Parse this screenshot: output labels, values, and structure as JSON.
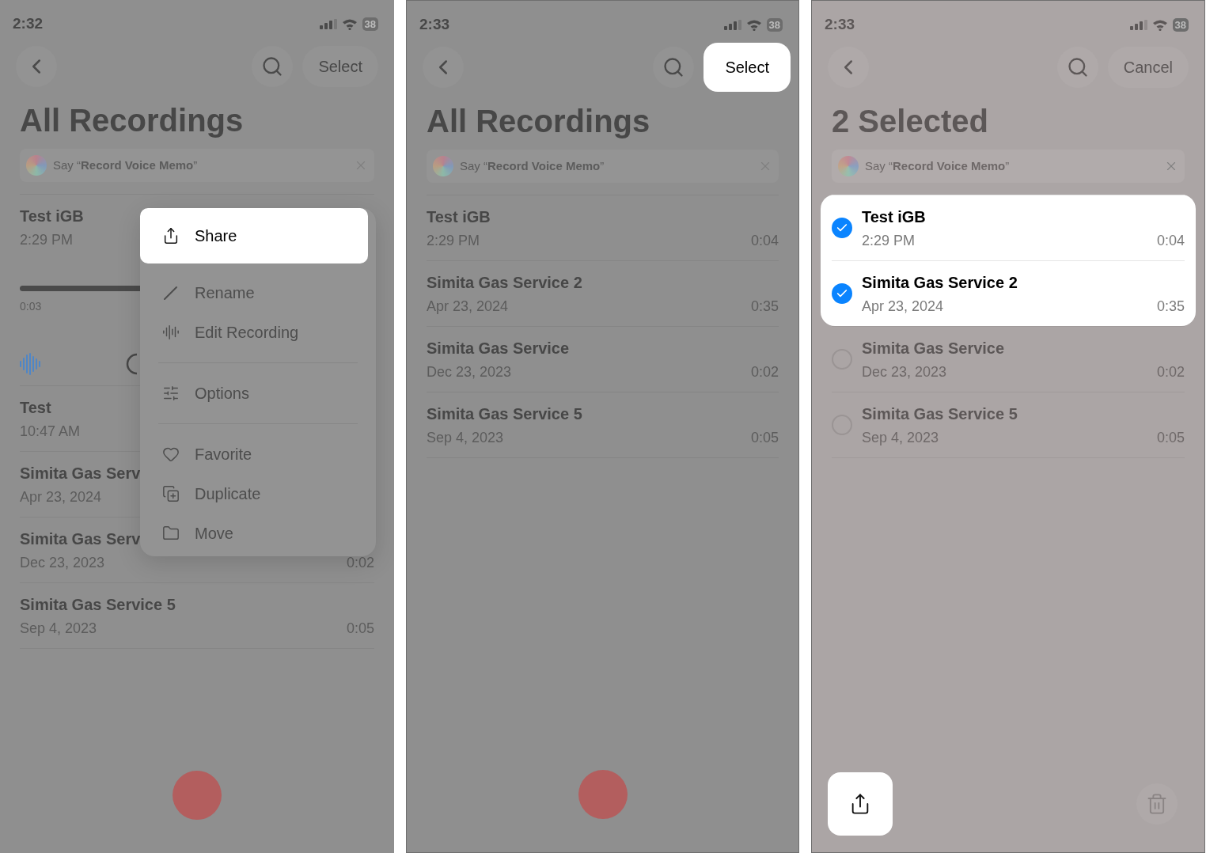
{
  "panels": [
    {
      "status_bar": {
        "time": "2:32",
        "battery": "38"
      },
      "nav": {
        "action": "Select",
        "action_highlighted": false
      },
      "title": "All Recordings",
      "siri_tip": "Say “**Record Voice Memo**”",
      "recordings": [
        {
          "title": "Test iGB",
          "subtitle": "2:29 PM",
          "expanded": true,
          "elapsed": "0:03"
        },
        {
          "title": "Test",
          "subtitle": "10:47 AM",
          "expanded": false
        },
        {
          "title": "Simita Gas Serv",
          "subtitle": "Apr 23, 2024",
          "expanded": false
        },
        {
          "title": "Simita Gas Serv",
          "subtitle": "Dec 23, 2023",
          "duration": "0:02",
          "expanded": false
        },
        {
          "title": "Simita Gas Service 5",
          "subtitle": "Sep 4, 2023",
          "duration": "0:05",
          "expanded": false
        }
      ],
      "context_menu": {
        "sections": [
          [
            {
              "kind": "share",
              "label": "Share",
              "highlighted": true
            },
            {
              "kind": "rename",
              "label": "Rename",
              "highlighted": false
            },
            {
              "kind": "edit",
              "label": "Edit Recording",
              "highlighted": false
            }
          ],
          [
            {
              "kind": "options",
              "label": "Options",
              "highlighted": false
            }
          ],
          [
            {
              "kind": "favorite",
              "label": "Favorite",
              "highlighted": false
            },
            {
              "kind": "duplicate",
              "label": "Duplicate",
              "highlighted": false
            },
            {
              "kind": "move",
              "label": "Move",
              "highlighted": false
            }
          ]
        ]
      },
      "bottom": {
        "kind": "record"
      }
    },
    {
      "status_bar": {
        "time": "2:33",
        "battery": "38"
      },
      "nav": {
        "action": "Select",
        "action_highlighted": true
      },
      "title": "All Recordings",
      "siri_tip": "Say “**Record Voice Memo**”",
      "recordings": [
        {
          "title": "Test iGB",
          "subtitle": "2:29 PM",
          "duration": "0:04"
        },
        {
          "title": "Simita Gas Service 2",
          "subtitle": "Apr 23, 2024",
          "duration": "0:35"
        },
        {
          "title": "Simita Gas Service",
          "subtitle": "Dec 23, 2023",
          "duration": "0:02"
        },
        {
          "title": "Simita Gas Service 5",
          "subtitle": "Sep 4, 2023",
          "duration": "0:05"
        }
      ],
      "bottom": {
        "kind": "record"
      }
    },
    {
      "status_bar": {
        "time": "2:33",
        "battery": "38"
      },
      "nav": {
        "action": "Cancel",
        "action_highlighted": false
      },
      "title": "2 Selected",
      "siri_tip": "Say “**Record Voice Memo**”",
      "recordings": [
        {
          "title": "Test iGB",
          "subtitle": "2:29 PM",
          "duration": "0:04",
          "selected": true
        },
        {
          "title": "Simita Gas Service 2",
          "subtitle": "Apr 23, 2024",
          "duration": "0:35",
          "selected": true
        },
        {
          "title": "Simita Gas Service",
          "subtitle": "Dec 23, 2023",
          "duration": "0:02",
          "selected": false
        },
        {
          "title": "Simita Gas Service 5",
          "subtitle": "Sep 4, 2023",
          "duration": "0:05",
          "selected": false
        }
      ],
      "bottom": {
        "kind": "toolbar",
        "items": [
          {
            "kind": "share",
            "highlighted": true
          },
          {
            "kind": "trash",
            "highlighted": false
          }
        ]
      }
    }
  ]
}
